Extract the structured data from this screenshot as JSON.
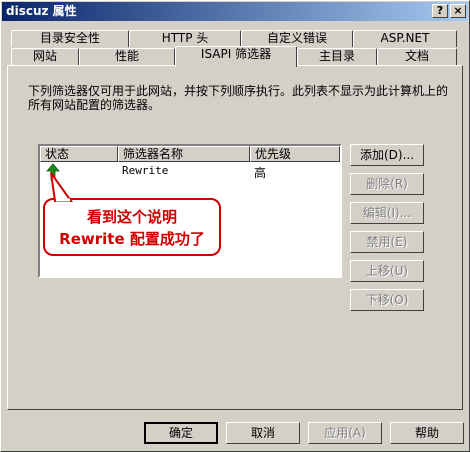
{
  "window": {
    "title": "discuz 属性",
    "help_label": "?",
    "close_label": "×"
  },
  "tabs_back": [
    {
      "label": "目录安全性"
    },
    {
      "label": "HTTP 头"
    },
    {
      "label": "自定义错误"
    },
    {
      "label": "ASP.NET"
    }
  ],
  "tabs_front": [
    {
      "label": "网站"
    },
    {
      "label": "性能"
    },
    {
      "label": "ISAPI 筛选器"
    },
    {
      "label": "主目录"
    },
    {
      "label": "文档"
    }
  ],
  "description": "下列筛选器仅可用于此网站，并按下列顺序执行。此列表不显示为此计算机上的所有网站配置的筛选器。",
  "list": {
    "columns": [
      "状态",
      "筛选器名称",
      "优先级"
    ],
    "rows": [
      {
        "name": "Rewrite",
        "priority": "高"
      }
    ]
  },
  "side_buttons": [
    "添加(D)...",
    "删除(R)",
    "编辑(I)...",
    "禁用(E)",
    "上移(U)",
    "下移(O)"
  ],
  "annotation": {
    "line1": "看到这个说明",
    "line2": "Rewrite 配置成功了"
  },
  "bottom_buttons": [
    "确定",
    "取消",
    "应用(A)",
    "帮助"
  ],
  "colors": {
    "annotation": "#d00000",
    "status_arrow": "#1a8a1a"
  }
}
